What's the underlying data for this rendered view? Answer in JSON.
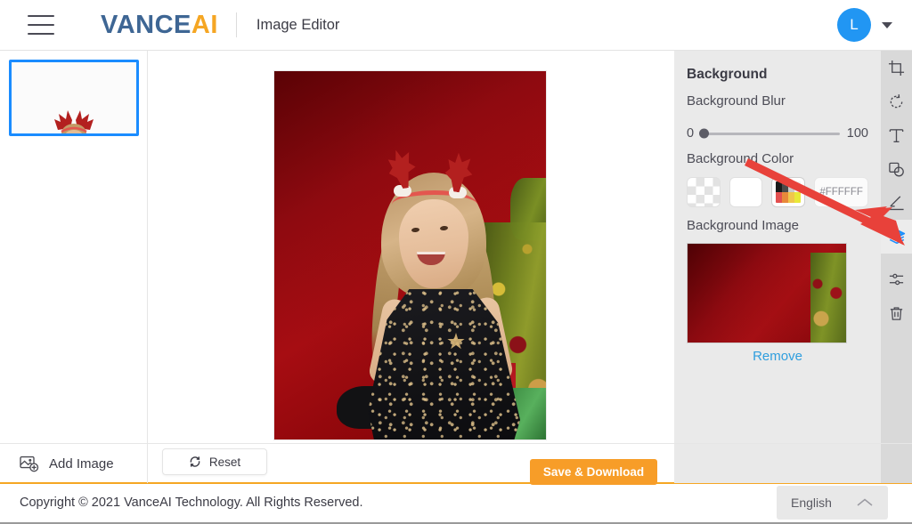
{
  "header": {
    "menu_icon": "hamburger-menu-icon",
    "logo_primary": "VANCE",
    "logo_accent": "AI",
    "app_title": "Image Editor",
    "avatar_initial": "L",
    "avatar_color": "#2196f3",
    "dropdown_icon": "chevron-down-icon"
  },
  "left_sidebar": {
    "thumbnail_alt": "layer-thumbnail",
    "selected_border_color": "#1a8cff"
  },
  "canvas": {
    "image_alt": "girl-with-reindeer-antlers-on-red-christmas-background"
  },
  "right_panel": {
    "title": "Background",
    "blur": {
      "label": "Background Blur",
      "min": "0",
      "max": "100",
      "value": 0
    },
    "color": {
      "label": "Background Color",
      "swatches": [
        {
          "name": "transparent-swatch",
          "type": "transparent"
        },
        {
          "name": "white-swatch",
          "type": "solid",
          "hex": "#FFFFFF"
        },
        {
          "name": "color-picker-swatch",
          "type": "picker"
        }
      ],
      "hex_value": "#FFFFFF"
    },
    "image": {
      "label": "Background Image",
      "thumbnail_alt": "red-christmas-tree-background-thumbnail",
      "remove_label": "Remove"
    }
  },
  "toolbar": {
    "items": [
      {
        "name": "crop-icon",
        "label": "Crop",
        "active": false
      },
      {
        "name": "rotate-icon",
        "label": "Rotate",
        "active": false
      },
      {
        "name": "text-icon",
        "label": "Text",
        "active": false
      },
      {
        "name": "shapes-icon",
        "label": "Shapes",
        "active": false
      },
      {
        "name": "draw-pen-icon",
        "label": "Draw",
        "active": false
      },
      {
        "name": "layers-icon",
        "label": "Layers",
        "active": true
      },
      {
        "name": "adjust-sliders-icon",
        "label": "Adjust",
        "active": false
      },
      {
        "name": "trash-icon",
        "label": "Delete",
        "active": false
      }
    ],
    "active_color": "#1a8cff"
  },
  "bottom_bar": {
    "add_image_label": "Add Image",
    "add_image_icon": "add-image-icon",
    "reset_label": "Reset",
    "reset_icon": "refresh-icon",
    "save_label": "Save & Download",
    "accent_color": "#f79d28"
  },
  "footer": {
    "copyright": "Copyright © 2021 VanceAI Technology. All Rights Reserved.",
    "language": "English",
    "language_caret_icon": "chevron-up-icon"
  },
  "annotation": {
    "arrow_color": "#e8413a",
    "points_to": "layers-icon"
  }
}
